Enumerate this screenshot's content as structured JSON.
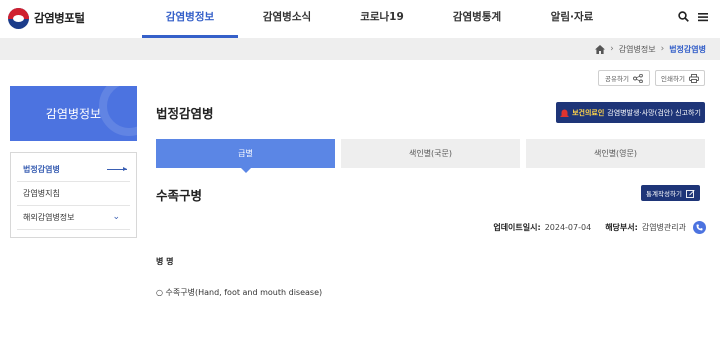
{
  "header": {
    "logo_text": "감염병포털",
    "nav": [
      "감염병정보",
      "감염병소식",
      "코로나19",
      "감염병통계",
      "알림·자료"
    ]
  },
  "breadcrumb": [
    "감염병정보",
    "법정감염병"
  ],
  "sidebar": {
    "title": "감염병정보",
    "items": [
      {
        "label": "법정감염병"
      },
      {
        "label": "감염병지침"
      },
      {
        "label": "해외감염병정보"
      }
    ]
  },
  "utility": {
    "share": "공유하기",
    "print": "인쇄하기"
  },
  "page": {
    "title": "법정감염병",
    "report_button_highlight": "보건의료인",
    "report_button_label": "감염병발생·사망(검안) 신고하기"
  },
  "tabs": [
    "급별",
    "색인별(국문)",
    "색인별(영문)"
  ],
  "section": {
    "title": "수족구병",
    "stats_button": "통계작성하기"
  },
  "meta": {
    "updated_label": "업데이트일시:",
    "updated_value": "2024-07-04",
    "dept_label": "해당부서:",
    "dept_value": "감염병관리과"
  },
  "detail": {
    "label": "병 명",
    "value": "○ 수족구병(Hand, foot and mouth disease)"
  },
  "colors": {
    "primary": "#4c73e0",
    "navy": "#1e3578",
    "accent": "#3560c9"
  }
}
